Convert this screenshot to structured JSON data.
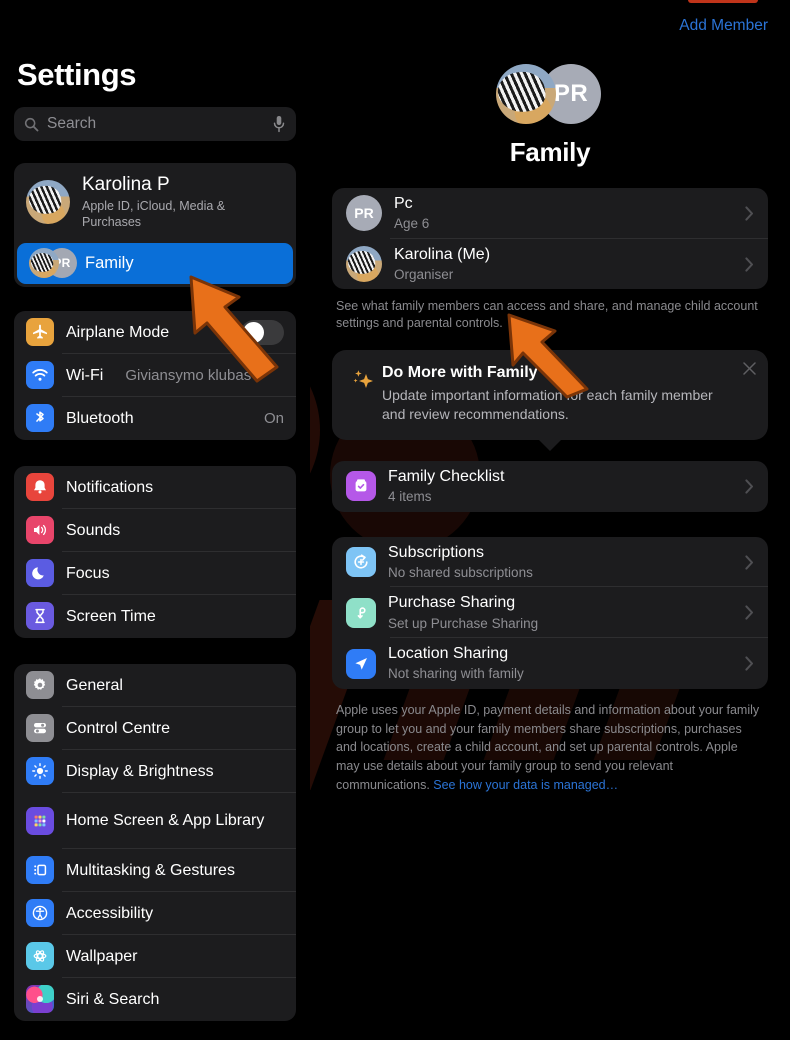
{
  "sidebar": {
    "title": "Settings",
    "search": {
      "placeholder": "Search",
      "value": ""
    },
    "account": {
      "name": "Karolina P",
      "subtitle": "Apple ID, iCloud, Media & Purchases",
      "family_label": "Family",
      "family_initials": "PR",
      "selected": true,
      "selected_color": "#0a6fd8"
    },
    "group_connectivity": [
      {
        "label": "Airplane Mode",
        "value": "",
        "control": "toggle",
        "toggle_on": false,
        "icon": "airplane-icon",
        "icon_color": "#e8a33d"
      },
      {
        "label": "Wi-Fi",
        "value": "Giviansymo klubas",
        "icon": "wifi-icon",
        "icon_color": "#2f7cf6"
      },
      {
        "label": "Bluetooth",
        "value": "On",
        "icon": "bluetooth-icon",
        "icon_color": "#2f7cf6"
      }
    ],
    "group_alerts": [
      {
        "label": "Notifications",
        "value": "",
        "icon": "bell-icon",
        "icon_color": "#e8453c"
      },
      {
        "label": "Sounds",
        "value": "",
        "icon": "speaker-icon",
        "icon_color": "#e8456a"
      },
      {
        "label": "Focus",
        "value": "",
        "icon": "moon-icon",
        "icon_color": "#5b5ce2"
      },
      {
        "label": "Screen Time",
        "value": "",
        "icon": "hourglass-icon",
        "icon_color": "#6a5ae0"
      }
    ],
    "group_system": [
      {
        "label": "General",
        "value": "",
        "icon": "gear-icon",
        "icon_color": "#8e8e93"
      },
      {
        "label": "Control Centre",
        "value": "",
        "icon": "sliders-icon",
        "icon_color": "#8e8e93"
      },
      {
        "label": "Display & Brightness",
        "value": "",
        "icon": "brightness-icon",
        "icon_color": "#2f7cf6"
      },
      {
        "label": "Home Screen & App Library",
        "value": "",
        "icon": "grid-icon",
        "icon_color": "#6a4ce0"
      },
      {
        "label": "Multitasking & Gestures",
        "value": "",
        "icon": "multitask-icon",
        "icon_color": "#2f7cf6"
      },
      {
        "label": "Accessibility",
        "value": "",
        "icon": "accessibility-icon",
        "icon_color": "#2f7cf6"
      },
      {
        "label": "Wallpaper",
        "value": "",
        "icon": "wallpaper-icon",
        "icon_color": "#5ac8e8"
      },
      {
        "label": "Siri & Search",
        "value": "",
        "icon": "siri-icon",
        "icon_color": "#c04aa0"
      }
    ]
  },
  "main": {
    "add_member_label": "Add Member",
    "add_member_color": "#2b74d6",
    "family_title": "Family",
    "family_initials": "PR",
    "members": [
      {
        "name": "Pc",
        "sub": "Age 6",
        "avatar": "initials",
        "initials": "PR"
      },
      {
        "name": "Karolina (Me)",
        "sub": "Organiser",
        "avatar": "photo",
        "initials": ""
      }
    ],
    "members_footnote": "See what family members can access and share, and manage child account settings and parental controls.",
    "promo": {
      "title": "Do More with Family",
      "body": "Update important information for each family member and review recommendations.",
      "icon": "sparkles-icon",
      "icon_color": "#e8a33d",
      "close_icon": "close-icon"
    },
    "checklist": {
      "label": "Family Checklist",
      "sub": "4 items",
      "icon": "checklist-icon",
      "icon_color": "#b558e8"
    },
    "sharing": [
      {
        "label": "Subscriptions",
        "sub": "No shared subscriptions",
        "icon": "subscriptions-icon",
        "icon_color": "#7ec4f5"
      },
      {
        "label": "Purchase Sharing",
        "sub": "Set up Purchase Sharing",
        "icon": "purchase-sharing-icon",
        "icon_color": "#8fe0c8"
      },
      {
        "label": "Location Sharing",
        "sub": "Not sharing with family",
        "icon": "location-icon",
        "icon_color": "#2f7cf6"
      }
    ],
    "legal_text": "Apple uses your Apple ID, payment details and information about your family group to let you and your family members share subscriptions, purchases and locations, create a child account, and set up parental controls. Apple may use details about your family group to send you relevant communications. ",
    "legal_link": "See how your data is managed…"
  },
  "annotations": {
    "arrow_color": "#e8701a",
    "arrows": [
      "points-to-family-sidebar-row",
      "points-to-karolina-member-row"
    ]
  }
}
